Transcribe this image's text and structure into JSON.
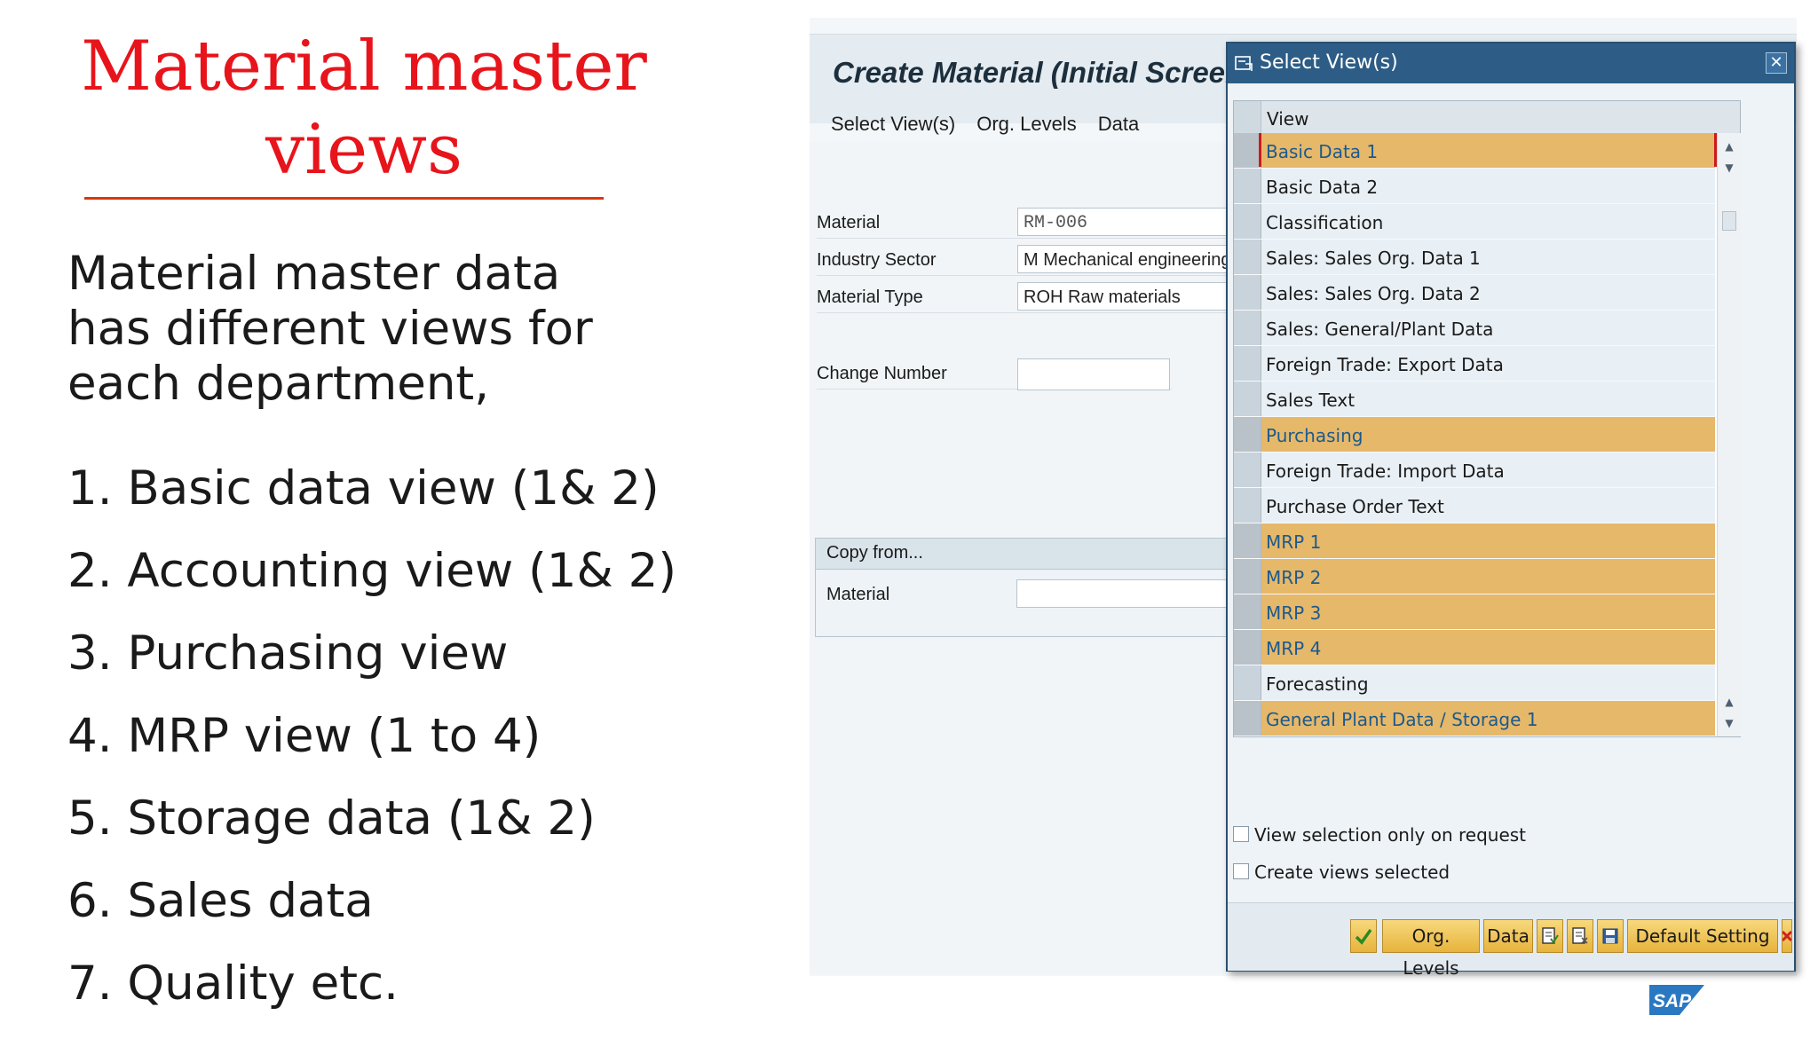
{
  "slide": {
    "title_line1": "Material master",
    "title_line2": "views",
    "intro": "Material master data has different views for each department,",
    "list": [
      "1. Basic data view (1& 2)",
      "2. Accounting view (1& 2)",
      "3. Purchasing view",
      "4. MRP view (1 to 4)",
      "5. Storage data (1& 2)",
      "6. Sales data",
      "7. Quality etc."
    ]
  },
  "main_window": {
    "title": "Create Material (Initial Screen)",
    "menu": [
      "Select View(s)",
      "Org. Levels",
      "Data"
    ],
    "fields": {
      "material_label": "Material",
      "material_value": "RM-006",
      "industry_label": "Industry Sector",
      "industry_value": "M Mechanical engineering",
      "type_label": "Material Type",
      "type_value": "ROH Raw materials",
      "change_label": "Change Number",
      "change_value": ""
    },
    "copy_from": {
      "title": "Copy from...",
      "material_label": "Material",
      "material_value": ""
    }
  },
  "dialog": {
    "title": "Select View(s)",
    "close_icon": "close-x-icon",
    "column_header": "View",
    "views": [
      {
        "label": "Basic Data 1",
        "selected": true
      },
      {
        "label": "Basic Data 2",
        "selected": false
      },
      {
        "label": "Classification",
        "selected": false
      },
      {
        "label": "Sales: Sales Org. Data 1",
        "selected": false
      },
      {
        "label": "Sales: Sales Org. Data 2",
        "selected": false
      },
      {
        "label": "Sales: General/Plant Data",
        "selected": false
      },
      {
        "label": "Foreign Trade: Export Data",
        "selected": false
      },
      {
        "label": "Sales Text",
        "selected": false
      },
      {
        "label": "Purchasing",
        "selected": true
      },
      {
        "label": "Foreign Trade: Import Data",
        "selected": false
      },
      {
        "label": "Purchase Order Text",
        "selected": false
      },
      {
        "label": "MRP 1",
        "selected": true
      },
      {
        "label": "MRP 2",
        "selected": true
      },
      {
        "label": "MRP 3",
        "selected": true
      },
      {
        "label": "MRP 4",
        "selected": true
      },
      {
        "label": "Forecasting",
        "selected": false
      },
      {
        "label": "General Plant Data / Storage 1",
        "selected": true
      }
    ],
    "options": [
      {
        "label": "View selection only on request",
        "checked": false
      },
      {
        "label": "Create views selected",
        "checked": false
      }
    ],
    "buttons": {
      "confirm_icon": "checkmark-icon",
      "org_levels": "Org. Levels",
      "data": "Data",
      "select_all_icon": "select-all-icon",
      "deselect_all_icon": "deselect-all-icon",
      "save_icon": "save-icon",
      "default_setting": "Default Setting",
      "cancel_icon": "cancel-x-icon"
    }
  },
  "brand": {
    "logo_text": "SAP"
  },
  "colors": {
    "title_red": "#e8141b",
    "selected_row": "#e6b86a",
    "dialog_header": "#2d5d86",
    "button_yellow": "#e7b33d"
  }
}
